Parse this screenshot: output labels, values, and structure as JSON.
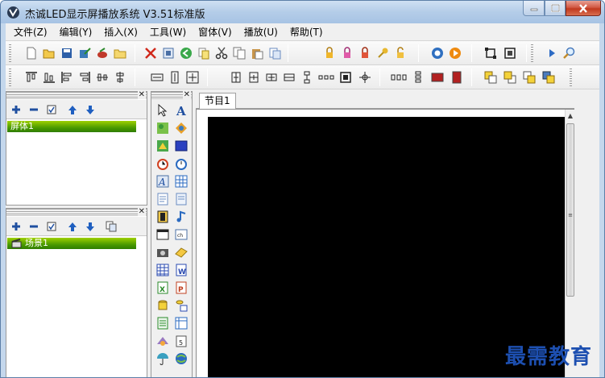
{
  "window": {
    "title": "杰诚LED显示屏播放系统 V3.51标准版"
  },
  "menu": [
    "文件(Z)",
    "编辑(Y)",
    "插入(X)",
    "工具(W)",
    "窗体(V)",
    "播放(U)",
    "帮助(T)"
  ],
  "toolbar1_icons": [
    "new-file-icon",
    "open-folder-icon",
    "save-icon",
    "save-as-icon",
    "export-icon",
    "folder-icon",
    "delete-icon",
    "properties-icon",
    "back-icon",
    "copy-page-icon",
    "cut-icon",
    "copy-icon",
    "paste-icon",
    "paste-special-icon",
    "lock-icon",
    "lock-pink-icon",
    "lock-red-icon",
    "key-icon",
    "unlock-icon",
    "record-icon",
    "play-icon",
    "fit-window-icon",
    "actual-size-icon",
    "run-icon",
    "zoom-icon"
  ],
  "toolbar2_icons": [
    "align-top-icon",
    "align-bottom-icon",
    "align-left-icon",
    "align-right-icon",
    "center-horizontal-icon",
    "center-vertical-icon",
    "same-width-icon",
    "same-height-icon",
    "same-size-icon",
    "distribute-h-icon",
    "distribute-v-icon",
    "space-h-icon",
    "space-v-icon",
    "space-equal-icon",
    "center-screen-icon",
    "move-icon",
    "tile-h-icon",
    "tile-v-icon",
    "fill-color-icon",
    "fill-dark-icon",
    "bring-front-icon",
    "send-back-icon",
    "bring-forward-icon",
    "send-backward-icon"
  ],
  "screen_panel": {
    "items": [
      "屏体1"
    ]
  },
  "scene_panel": {
    "items": [
      "场景1"
    ]
  },
  "editor": {
    "tabs": [
      "节目1"
    ]
  },
  "watermark": "最需教育",
  "colors": {
    "accent_green": "#4b9a00",
    "canvas": "#000000",
    "watermark": "#1d4fb0"
  }
}
